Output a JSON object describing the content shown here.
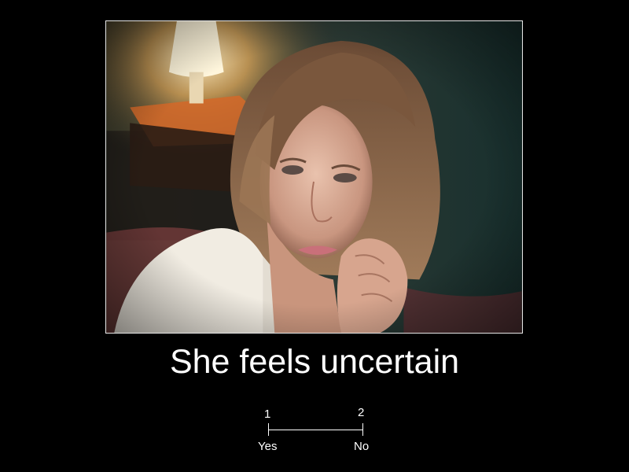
{
  "caption": "She feels uncertain",
  "scale": {
    "left_number": "1",
    "right_number": "2",
    "left_label": "Yes",
    "right_label": "No"
  },
  "colors": {
    "background": "#000000",
    "text": "#ffffff",
    "frame_border": "#e6e6e6"
  }
}
